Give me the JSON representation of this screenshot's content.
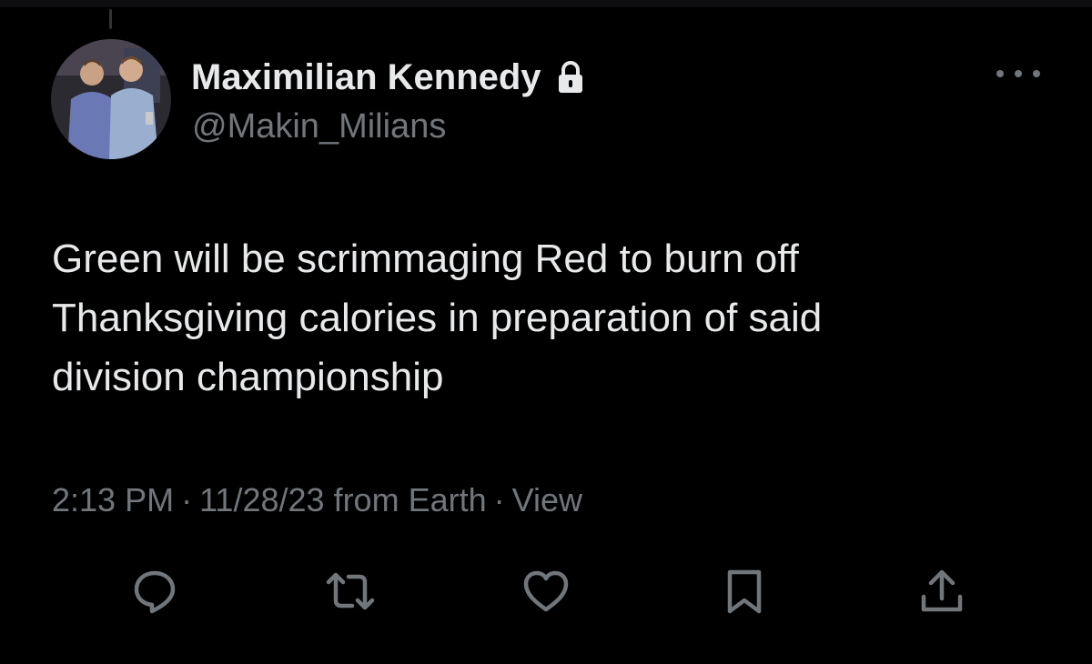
{
  "tweet": {
    "author": {
      "display_name": "Maximilian Kennedy",
      "handle": "@Makin_Milians",
      "protected_icon": "lock-icon",
      "avatar": "avatar-photo"
    },
    "text_lines": [
      "Green will be scrimmaging Red to burn off",
      "Thanksgiving calories in preparation of said",
      "division championship"
    ],
    "meta": {
      "time": "2:13 PM",
      "separator": "·",
      "date": "11/28/23",
      "source": "from Earth",
      "view_link": "View"
    },
    "more_icon": "more-horizontal-icon",
    "actions": [
      {
        "name": "reply",
        "icon": "comment-icon"
      },
      {
        "name": "repost",
        "icon": "repost-icon"
      },
      {
        "name": "like",
        "icon": "heart-icon"
      },
      {
        "name": "bookmark",
        "icon": "bookmark-icon"
      },
      {
        "name": "share",
        "icon": "share-icon"
      }
    ]
  },
  "colors": {
    "background": "#000000",
    "primary_text": "#e7e9ea",
    "secondary_text": "#71767b"
  }
}
